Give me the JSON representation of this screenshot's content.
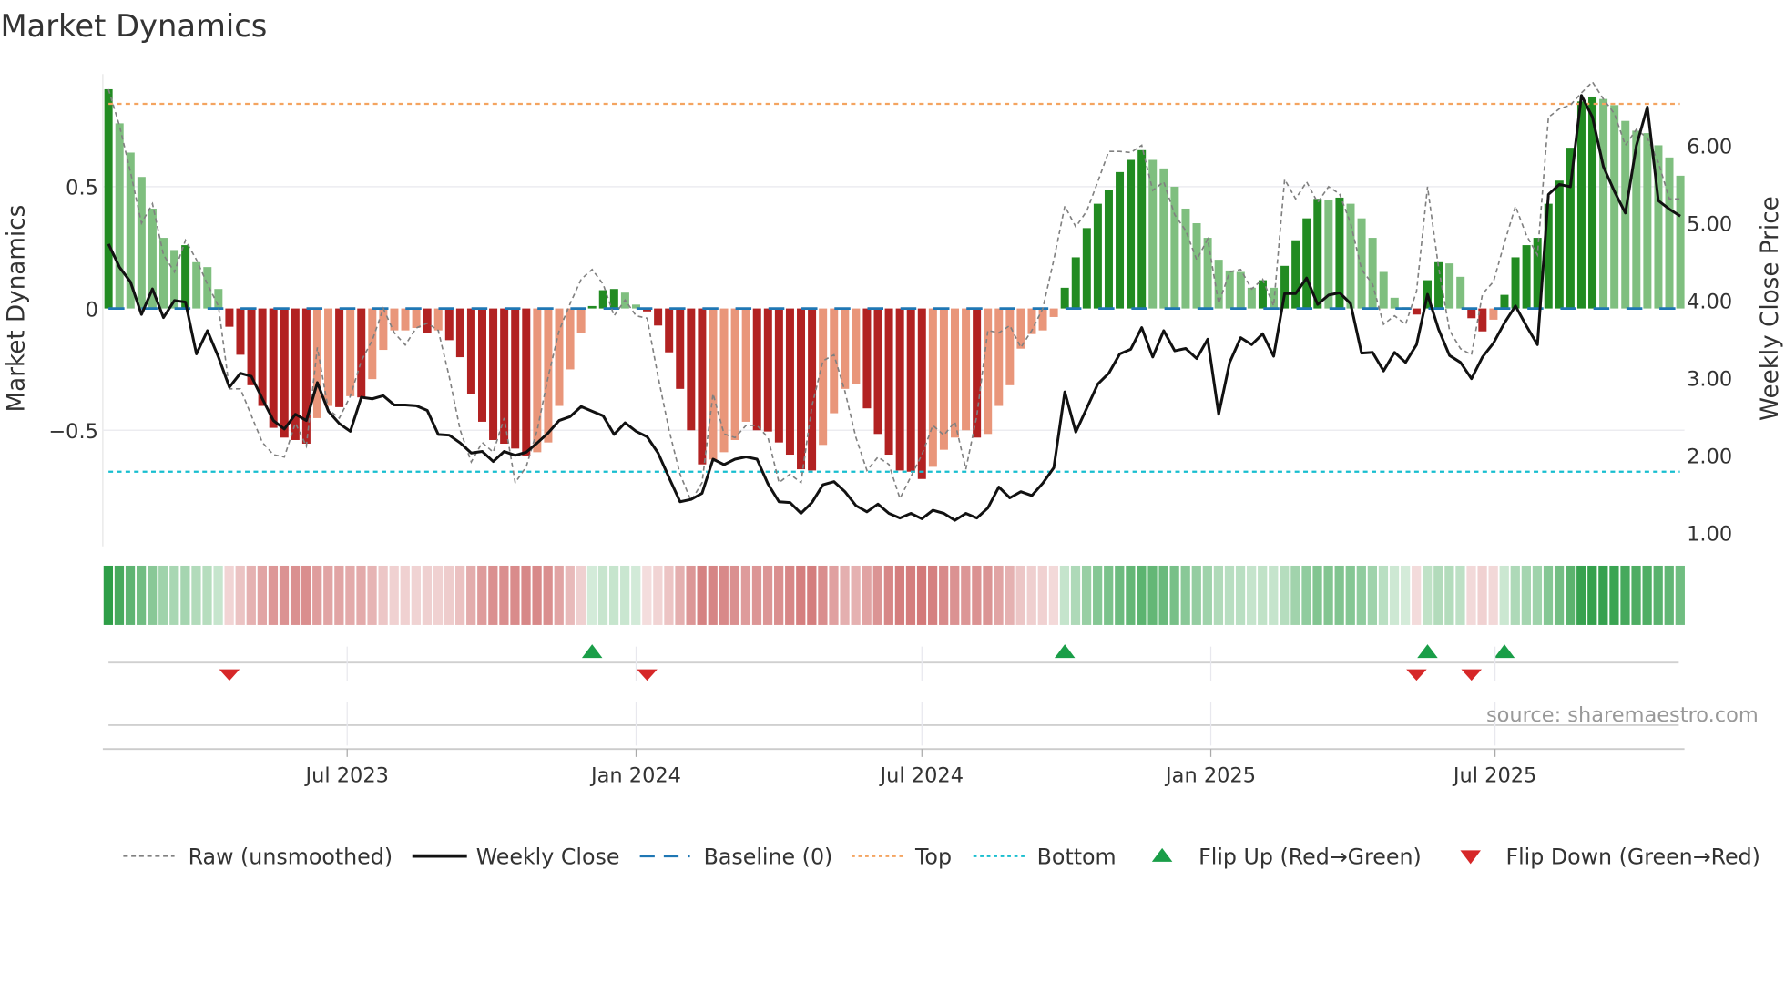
{
  "title": "Market Dynamics",
  "source": "source: sharemaestro.com",
  "colors": {
    "green_dark": "#228b22",
    "green_light": "#7fbf7f",
    "red_dark": "#b22222",
    "red_light": "#e9967a",
    "baseline": "#1f77b4",
    "top": "#f4a460",
    "bottom": "#17becf",
    "raw": "#808080",
    "close": "#111111",
    "flip_up": "#1a9e48",
    "flip_down": "#d62728"
  },
  "legend": {
    "raw": "Raw (unsmoothed)",
    "close": "Weekly Close",
    "baseline": "Baseline (0)",
    "top": "Top",
    "bottom": "Bottom",
    "flip_up": "Flip Up (Red→Green)",
    "flip_down": "Flip Down (Green→Red)"
  },
  "chart_data": {
    "type": "bar",
    "title": "Market Dynamics",
    "ylabel": "Market Dynamics",
    "y2label": "Weekly Close Price",
    "start_date": "2023-01-30",
    "frequency": "weekly",
    "ylim": [
      -0.98,
      0.96
    ],
    "y2lim": [
      0.82,
      6.93
    ],
    "yticks": [
      {
        "v": -0.5,
        "label": "−0.5"
      },
      {
        "v": 0,
        "label": "0"
      },
      {
        "v": 0.5,
        "label": "0.5"
      }
    ],
    "y2ticks": [
      {
        "v": 1,
        "label": "1.00"
      },
      {
        "v": 2,
        "label": "2.00"
      },
      {
        "v": 3,
        "label": "3.00"
      },
      {
        "v": 4,
        "label": "4.00"
      },
      {
        "v": 5,
        "label": "5.00"
      },
      {
        "v": 6,
        "label": "6.00"
      }
    ],
    "xticks": [
      {
        "date": "2023-07-01",
        "label": "Jul 2023"
      },
      {
        "date": "2024-01-01",
        "label": "Jan 2024"
      },
      {
        "date": "2024-07-01",
        "label": "Jul 2024"
      },
      {
        "date": "2025-01-01",
        "label": "Jan 2025"
      },
      {
        "date": "2025-07-01",
        "label": "Jul 2025"
      }
    ],
    "top": 0.84,
    "bottom": -0.67,
    "baseline": 0,
    "momentum": [
      0.9,
      0.76,
      0.64,
      0.54,
      0.41,
      0.29,
      0.24,
      0.26,
      0.19,
      0.17,
      0.08,
      -0.075,
      -0.19,
      -0.315,
      -0.4,
      -0.49,
      -0.53,
      -0.54,
      -0.555,
      -0.45,
      -0.4,
      -0.405,
      -0.36,
      -0.365,
      -0.29,
      -0.17,
      -0.09,
      -0.09,
      -0.08,
      -0.1,
      -0.09,
      -0.13,
      -0.2,
      -0.35,
      -0.465,
      -0.54,
      -0.555,
      -0.575,
      -0.605,
      -0.59,
      -0.55,
      -0.4,
      -0.25,
      -0.1,
      0.01,
      0.075,
      0.08,
      0.065,
      0.016,
      -0.012,
      -0.07,
      -0.18,
      -0.33,
      -0.5,
      -0.64,
      -0.62,
      -0.59,
      -0.54,
      -0.465,
      -0.5,
      -0.505,
      -0.55,
      -0.6,
      -0.66,
      -0.665,
      -0.56,
      -0.43,
      -0.33,
      -0.31,
      -0.41,
      -0.515,
      -0.6,
      -0.665,
      -0.67,
      -0.7,
      -0.65,
      -0.58,
      -0.53,
      -0.5,
      -0.53,
      -0.515,
      -0.4,
      -0.315,
      -0.165,
      -0.105,
      -0.09,
      -0.035,
      0.085,
      0.21,
      0.33,
      0.43,
      0.485,
      0.56,
      0.61,
      0.65,
      0.61,
      0.575,
      0.5,
      0.41,
      0.35,
      0.29,
      0.2,
      0.156,
      0.15,
      0.085,
      0.116,
      0.085,
      0.175,
      0.28,
      0.37,
      0.45,
      0.445,
      0.455,
      0.43,
      0.37,
      0.29,
      0.15,
      0.044,
      0.005,
      -0.025,
      0.116,
      0.19,
      0.185,
      0.13,
      -0.04,
      -0.094,
      -0.046,
      0.056,
      0.21,
      0.26,
      0.29,
      0.43,
      0.525,
      0.66,
      0.85,
      0.87,
      0.86,
      0.835,
      0.77,
      0.73,
      0.72,
      0.67,
      0.62,
      0.545
    ],
    "raw": [
      0.9,
      0.75,
      0.56,
      0.35,
      0.43,
      0.22,
      0.15,
      0.28,
      0.2,
      0.1,
      0.01,
      -0.33,
      -0.33,
      -0.44,
      -0.55,
      -0.6,
      -0.61,
      -0.47,
      -0.565,
      -0.16,
      -0.415,
      -0.45,
      -0.36,
      -0.215,
      -0.13,
      0,
      -0.1,
      -0.15,
      -0.08,
      -0.06,
      -0.09,
      -0.28,
      -0.5,
      -0.63,
      -0.55,
      -0.59,
      -0.45,
      -0.715,
      -0.65,
      -0.5,
      -0.28,
      -0.09,
      0.02,
      0.12,
      0.16,
      0.1,
      -0.03,
      0.035,
      -0.03,
      -0.04,
      -0.28,
      -0.5,
      -0.68,
      -0.79,
      -0.715,
      -0.35,
      -0.515,
      -0.53,
      -0.48,
      -0.48,
      -0.53,
      -0.715,
      -0.68,
      -0.715,
      -0.4,
      -0.215,
      -0.19,
      -0.34,
      -0.53,
      -0.665,
      -0.61,
      -0.64,
      -0.78,
      -0.69,
      -0.6,
      -0.48,
      -0.52,
      -0.465,
      -0.66,
      -0.44,
      -0.09,
      -0.1,
      -0.07,
      -0.16,
      -0.09,
      0,
      0.2,
      0.42,
      0.335,
      0.4,
      0.52,
      0.645,
      0.645,
      0.64,
      0.67,
      0.485,
      0.52,
      0.385,
      0.32,
      0.2,
      0.285,
      0.02,
      0.15,
      0.16,
      0.08,
      0.12,
      0.01,
      0.53,
      0.45,
      0.52,
      0.435,
      0.5,
      0.47,
      0.35,
      0.16,
      0.1,
      -0.065,
      -0.03,
      -0.065,
      0.07,
      0.5,
      0.17,
      -0.09,
      -0.165,
      -0.19,
      0.06,
      0.11,
      0.27,
      0.42,
      0.3,
      0.22,
      0.785,
      0.82,
      0.835,
      0.885,
      0.93,
      0.86,
      0.8,
      0.67,
      0.735,
      0.7,
      0.6,
      0.45,
      0.45
    ],
    "close": [
      4.73,
      4.43,
      4.24,
      3.82,
      4.15,
      3.78,
      4.0,
      3.98,
      3.31,
      3.61,
      3.27,
      2.88,
      3.06,
      3.02,
      2.73,
      2.45,
      2.34,
      2.53,
      2.45,
      2.94,
      2.57,
      2.41,
      2.31,
      2.75,
      2.73,
      2.77,
      2.65,
      2.65,
      2.64,
      2.58,
      2.27,
      2.26,
      2.16,
      2.03,
      2.05,
      1.92,
      2.05,
      2.0,
      2.04,
      2.16,
      2.29,
      2.45,
      2.5,
      2.63,
      2.57,
      2.51,
      2.27,
      2.42,
      2.31,
      2.24,
      2.03,
      1.71,
      1.4,
      1.43,
      1.51,
      1.95,
      1.88,
      1.95,
      1.98,
      1.95,
      1.63,
      1.4,
      1.39,
      1.25,
      1.39,
      1.62,
      1.66,
      1.53,
      1.35,
      1.27,
      1.37,
      1.25,
      1.19,
      1.25,
      1.18,
      1.29,
      1.25,
      1.16,
      1.25,
      1.19,
      1.32,
      1.59,
      1.45,
      1.53,
      1.48,
      1.64,
      1.84,
      2.82,
      2.3,
      2.61,
      2.92,
      3.06,
      3.31,
      3.37,
      3.65,
      3.27,
      3.61,
      3.35,
      3.38,
      3.25,
      3.5,
      2.53,
      3.2,
      3.52,
      3.43,
      3.57,
      3.28,
      4.09,
      4.09,
      4.29,
      3.95,
      4.07,
      4.1,
      3.96,
      3.32,
      3.33,
      3.09,
      3.33,
      3.2,
      3.43,
      4.08,
      3.63,
      3.29,
      3.2,
      2.99,
      3.27,
      3.45,
      3.71,
      3.93,
      3.67,
      3.43,
      5.37,
      5.5,
      5.47,
      6.65,
      6.37,
      5.73,
      5.41,
      5.13,
      6.0,
      6.5,
      5.29,
      5.18,
      5.09
    ],
    "flip_up_idx": [
      44,
      87,
      120,
      127
    ],
    "flip_down_idx": [
      11,
      49,
      119,
      124
    ]
  }
}
